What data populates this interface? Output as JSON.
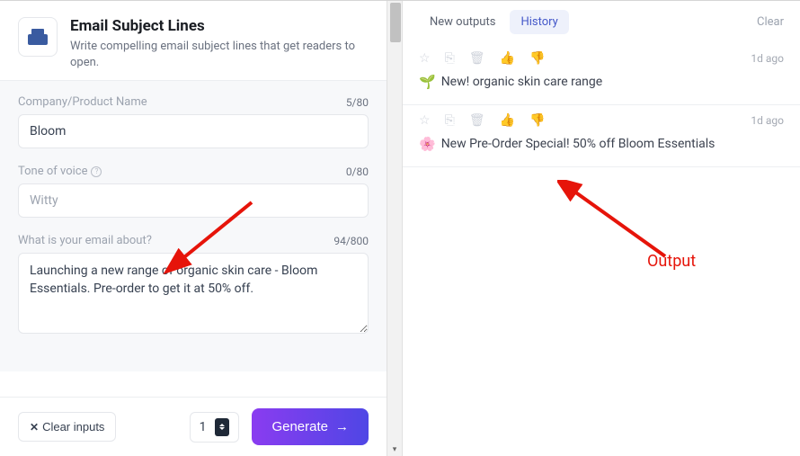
{
  "header": {
    "title": "Email Subject Lines",
    "subtitle": "Write compelling email subject lines that get readers to open."
  },
  "form": {
    "company": {
      "label": "Company/Product Name",
      "value": "Bloom",
      "count": "5/80"
    },
    "tone": {
      "label": "Tone of voice",
      "placeholder": "Witty",
      "value": "",
      "count": "0/80"
    },
    "about": {
      "label": "What is your email about?",
      "value": "Launching a new range of organic skin care - Bloom Essentials. Pre-order to get it at 50% off.",
      "count": "94/800"
    }
  },
  "footer": {
    "clear_label": "Clear inputs",
    "quantity": "1",
    "generate_label": "Generate"
  },
  "tabs": {
    "new_outputs": "New outputs",
    "history": "History",
    "clear": "Clear"
  },
  "outputs": [
    {
      "emoji": "🌱",
      "text": "New! organic skin care range",
      "timestamp": "1d ago"
    },
    {
      "emoji": "🌸",
      "text": "New Pre-Order Special! 50% off Bloom Essentials",
      "timestamp": "1d ago"
    }
  ],
  "annotation": {
    "label": "Output"
  }
}
